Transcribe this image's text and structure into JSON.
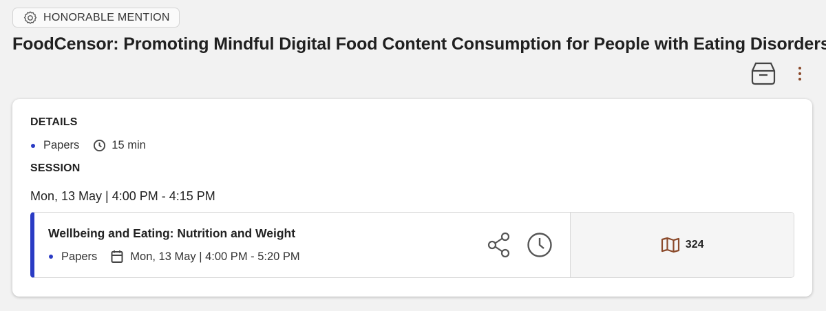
{
  "award": {
    "label": "HONORABLE MENTION",
    "icon": "award-badge-icon"
  },
  "page": {
    "title": "FoodCensor: Promoting Mindful Digital Food Content Consumption for People with Eating Disorders"
  },
  "actions": {
    "archive_icon": "archive-icon",
    "more_icon": "more-vertical-icon"
  },
  "details": {
    "heading": "DETAILS",
    "type": "Papers",
    "duration": "15 min"
  },
  "session": {
    "heading": "SESSION",
    "time": "Mon, 13 May | 4:00 PM - 4:15 PM",
    "title": "Wellbeing and Eating: Nutrition and Weight",
    "type": "Papers",
    "date_time": "Mon, 13 May | 4:00 PM - 5:20 PM",
    "room": "324"
  },
  "colors": {
    "accent": "#2a3bc4",
    "brand": "#8b4a2b",
    "background": "#f2f2f2"
  }
}
